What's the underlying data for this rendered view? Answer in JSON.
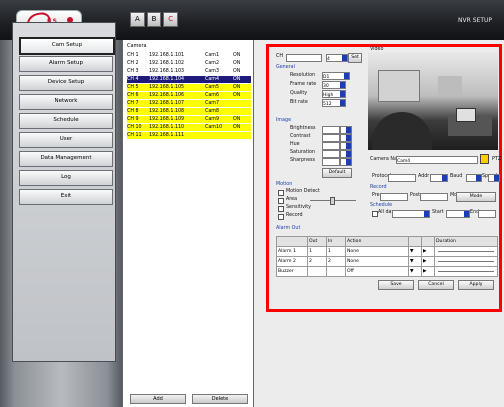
{
  "app": {
    "logo_text": "KS",
    "title": "NVR SETUP",
    "toolbar": [
      "A",
      "B",
      "C"
    ]
  },
  "nav": {
    "items": [
      {
        "label": "Cam Setup",
        "active": true
      },
      {
        "label": "Alarm Setup",
        "active": false
      },
      {
        "label": "Device Setup",
        "active": false
      },
      {
        "label": "Network",
        "active": false
      },
      {
        "label": "Schedule",
        "active": false
      },
      {
        "label": "User",
        "active": false
      },
      {
        "label": "Data Management",
        "active": false
      },
      {
        "label": "Log",
        "active": false
      },
      {
        "label": "Exit",
        "active": false
      }
    ]
  },
  "channel_list": {
    "header": "Camera",
    "rows": [
      {
        "cells": [
          "CH 1",
          "192.168.1.101",
          "Cam1",
          "ON"
        ],
        "style": "plain"
      },
      {
        "cells": [
          "CH 2",
          "192.168.1.102",
          "Cam2",
          "ON"
        ],
        "style": "plain"
      },
      {
        "cells": [
          "CH 3",
          "192.168.1.103",
          "Cam3",
          "ON"
        ],
        "style": "plain"
      },
      {
        "cells": [
          "CH 4",
          "192.168.1.104",
          "Cam4",
          "ON"
        ],
        "style": "selected"
      },
      {
        "cells": [
          "CH 5",
          "192.168.1.105",
          "Cam5",
          "ON"
        ],
        "style": "yellow"
      },
      {
        "cells": [
          "CH 6",
          "192.168.1.106",
          "Cam6",
          "ON"
        ],
        "style": "yellow"
      },
      {
        "cells": [
          "CH 7",
          "192.168.1.107",
          "Cam7",
          ""
        ],
        "style": "yellow"
      },
      {
        "cells": [
          "CH 8",
          "192.168.1.108",
          "Cam8",
          ""
        ],
        "style": "yellow"
      },
      {
        "cells": [
          "CH 9",
          "192.168.1.109",
          "Cam9",
          "ON"
        ],
        "style": "yellow"
      },
      {
        "cells": [
          "CH 10",
          "192.168.1.110",
          "Cam10",
          "ON"
        ],
        "style": "yellow"
      },
      {
        "cells": [
          "CH 11",
          "192.168.1.111",
          "",
          ""
        ],
        "style": "yellow"
      }
    ],
    "buttons": [
      "Add",
      "Delete"
    ]
  },
  "settings": {
    "channel_label": "CH",
    "channel_value": "4",
    "channel_btn": "Set",
    "video_label": "Video",
    "general_title": "General",
    "fields": [
      {
        "label": "Resolution",
        "value": "D1"
      },
      {
        "label": "Frame rate",
        "value": "30"
      },
      {
        "label": "Quality",
        "value": "High"
      },
      {
        "label": "Bit rate",
        "value": "512"
      }
    ],
    "image_title": "Image",
    "image_fields": [
      {
        "label": "Brightness",
        "value": "50"
      },
      {
        "label": "Contrast",
        "value": "50"
      },
      {
        "label": "Hue",
        "value": "50"
      },
      {
        "label": "Saturation",
        "value": "50"
      },
      {
        "label": "Sharpness",
        "value": "50"
      }
    ],
    "image_btn": "Default",
    "name_label": "Camera Name",
    "name_value": "Cam4",
    "ptz_label": "PTZ",
    "ptz_options": [
      "Protocol",
      "Addr",
      "Baud",
      "Speed"
    ],
    "motion_title": "Motion",
    "motion_options": [
      "Motion Detect",
      "Area",
      "Sensitivity",
      "Record"
    ],
    "record_title": "Record",
    "record_fields": [
      "Pre",
      "Post",
      "Mode"
    ],
    "schedule_title": "Schedule",
    "schedule_fields": [
      "All day",
      "Start",
      "End"
    ],
    "alarm_title": "Alarm Out",
    "alarm_headers": [
      "",
      "Out",
      "In",
      "Action",
      "",
      "",
      "Duration"
    ],
    "alarm_rows": [
      {
        "name": "Alarm 1",
        "a": "1",
        "b": "1",
        "action": "None"
      },
      {
        "name": "Alarm 2",
        "a": "2",
        "b": "2",
        "action": "None"
      },
      {
        "name": "Buzzer",
        "a": "",
        "b": "",
        "action": "Off"
      }
    ],
    "buttons": [
      "Save",
      "Cancel",
      "Apply"
    ]
  }
}
